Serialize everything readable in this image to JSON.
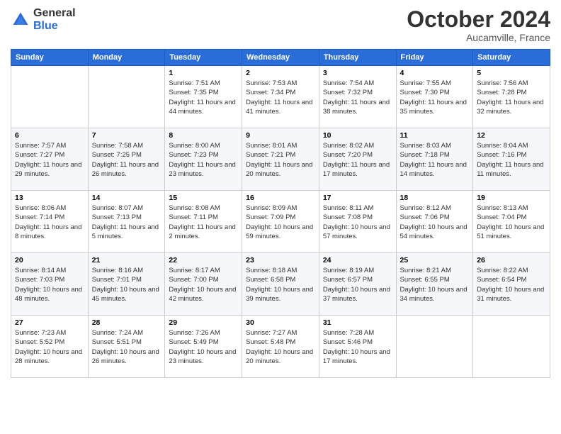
{
  "logo": {
    "general": "General",
    "blue": "Blue"
  },
  "header": {
    "month": "October 2024",
    "location": "Aucamville, France"
  },
  "weekdays": [
    "Sunday",
    "Monday",
    "Tuesday",
    "Wednesday",
    "Thursday",
    "Friday",
    "Saturday"
  ],
  "weeks": [
    [
      {
        "day": "",
        "info": ""
      },
      {
        "day": "",
        "info": ""
      },
      {
        "day": "1",
        "info": "Sunrise: 7:51 AM\nSunset: 7:35 PM\nDaylight: 11 hours and 44 minutes."
      },
      {
        "day": "2",
        "info": "Sunrise: 7:53 AM\nSunset: 7:34 PM\nDaylight: 11 hours and 41 minutes."
      },
      {
        "day": "3",
        "info": "Sunrise: 7:54 AM\nSunset: 7:32 PM\nDaylight: 11 hours and 38 minutes."
      },
      {
        "day": "4",
        "info": "Sunrise: 7:55 AM\nSunset: 7:30 PM\nDaylight: 11 hours and 35 minutes."
      },
      {
        "day": "5",
        "info": "Sunrise: 7:56 AM\nSunset: 7:28 PM\nDaylight: 11 hours and 32 minutes."
      }
    ],
    [
      {
        "day": "6",
        "info": "Sunrise: 7:57 AM\nSunset: 7:27 PM\nDaylight: 11 hours and 29 minutes."
      },
      {
        "day": "7",
        "info": "Sunrise: 7:58 AM\nSunset: 7:25 PM\nDaylight: 11 hours and 26 minutes."
      },
      {
        "day": "8",
        "info": "Sunrise: 8:00 AM\nSunset: 7:23 PM\nDaylight: 11 hours and 23 minutes."
      },
      {
        "day": "9",
        "info": "Sunrise: 8:01 AM\nSunset: 7:21 PM\nDaylight: 11 hours and 20 minutes."
      },
      {
        "day": "10",
        "info": "Sunrise: 8:02 AM\nSunset: 7:20 PM\nDaylight: 11 hours and 17 minutes."
      },
      {
        "day": "11",
        "info": "Sunrise: 8:03 AM\nSunset: 7:18 PM\nDaylight: 11 hours and 14 minutes."
      },
      {
        "day": "12",
        "info": "Sunrise: 8:04 AM\nSunset: 7:16 PM\nDaylight: 11 hours and 11 minutes."
      }
    ],
    [
      {
        "day": "13",
        "info": "Sunrise: 8:06 AM\nSunset: 7:14 PM\nDaylight: 11 hours and 8 minutes."
      },
      {
        "day": "14",
        "info": "Sunrise: 8:07 AM\nSunset: 7:13 PM\nDaylight: 11 hours and 5 minutes."
      },
      {
        "day": "15",
        "info": "Sunrise: 8:08 AM\nSunset: 7:11 PM\nDaylight: 11 hours and 2 minutes."
      },
      {
        "day": "16",
        "info": "Sunrise: 8:09 AM\nSunset: 7:09 PM\nDaylight: 10 hours and 59 minutes."
      },
      {
        "day": "17",
        "info": "Sunrise: 8:11 AM\nSunset: 7:08 PM\nDaylight: 10 hours and 57 minutes."
      },
      {
        "day": "18",
        "info": "Sunrise: 8:12 AM\nSunset: 7:06 PM\nDaylight: 10 hours and 54 minutes."
      },
      {
        "day": "19",
        "info": "Sunrise: 8:13 AM\nSunset: 7:04 PM\nDaylight: 10 hours and 51 minutes."
      }
    ],
    [
      {
        "day": "20",
        "info": "Sunrise: 8:14 AM\nSunset: 7:03 PM\nDaylight: 10 hours and 48 minutes."
      },
      {
        "day": "21",
        "info": "Sunrise: 8:16 AM\nSunset: 7:01 PM\nDaylight: 10 hours and 45 minutes."
      },
      {
        "day": "22",
        "info": "Sunrise: 8:17 AM\nSunset: 7:00 PM\nDaylight: 10 hours and 42 minutes."
      },
      {
        "day": "23",
        "info": "Sunrise: 8:18 AM\nSunset: 6:58 PM\nDaylight: 10 hours and 39 minutes."
      },
      {
        "day": "24",
        "info": "Sunrise: 8:19 AM\nSunset: 6:57 PM\nDaylight: 10 hours and 37 minutes."
      },
      {
        "day": "25",
        "info": "Sunrise: 8:21 AM\nSunset: 6:55 PM\nDaylight: 10 hours and 34 minutes."
      },
      {
        "day": "26",
        "info": "Sunrise: 8:22 AM\nSunset: 6:54 PM\nDaylight: 10 hours and 31 minutes."
      }
    ],
    [
      {
        "day": "27",
        "info": "Sunrise: 7:23 AM\nSunset: 5:52 PM\nDaylight: 10 hours and 28 minutes."
      },
      {
        "day": "28",
        "info": "Sunrise: 7:24 AM\nSunset: 5:51 PM\nDaylight: 10 hours and 26 minutes."
      },
      {
        "day": "29",
        "info": "Sunrise: 7:26 AM\nSunset: 5:49 PM\nDaylight: 10 hours and 23 minutes."
      },
      {
        "day": "30",
        "info": "Sunrise: 7:27 AM\nSunset: 5:48 PM\nDaylight: 10 hours and 20 minutes."
      },
      {
        "day": "31",
        "info": "Sunrise: 7:28 AM\nSunset: 5:46 PM\nDaylight: 10 hours and 17 minutes."
      },
      {
        "day": "",
        "info": ""
      },
      {
        "day": "",
        "info": ""
      }
    ]
  ]
}
